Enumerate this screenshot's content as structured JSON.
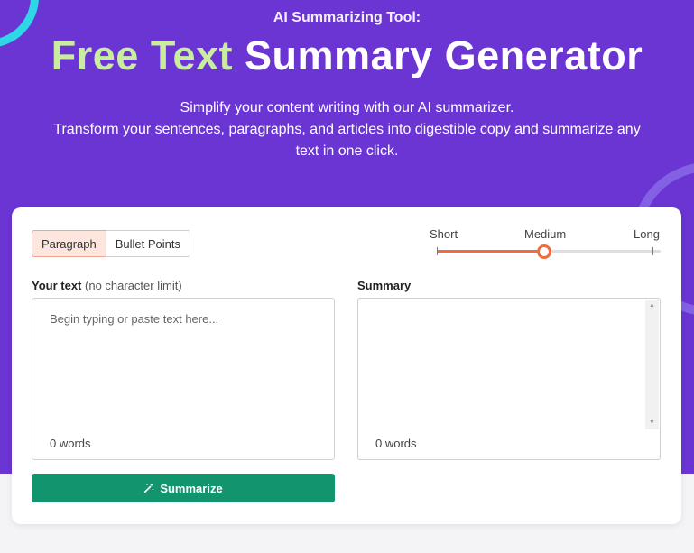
{
  "hero": {
    "eyebrow": "AI Summarizing Tool:",
    "title_accent": "Free Text",
    "title_main": "Summary Generator",
    "subtitle_line1": "Simplify your content writing with our AI summarizer.",
    "subtitle_line2": "Transform your sentences, paragraphs, and articles into digestible copy and summarize any",
    "subtitle_line3": "text in one click."
  },
  "mode": {
    "options": [
      "Paragraph",
      "Bullet Points"
    ],
    "selected": "Paragraph"
  },
  "length": {
    "labels": [
      "Short",
      "Medium",
      "Long"
    ],
    "selected": "Medium"
  },
  "input": {
    "label": "Your text",
    "hint": "(no character limit)",
    "placeholder": "Begin typing or paste text here...",
    "word_count": "0 words"
  },
  "output": {
    "label": "Summary",
    "word_count": "0 words"
  },
  "actions": {
    "summarize_label": "Summarize"
  },
  "colors": {
    "hero_bg": "#6a35d3",
    "accent_green": "#c9ec9f",
    "slider": "#f26b3a",
    "button": "#12946f"
  },
  "icons": [
    "wand-icon"
  ]
}
